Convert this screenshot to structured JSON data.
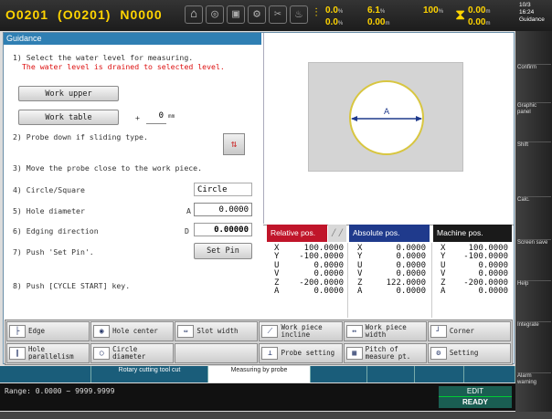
{
  "header": {
    "o_number": "O0201",
    "o_sub": "(O0201)",
    "n_number": "N0000",
    "stat1_a": "0.0",
    "stat1_a_unit": "%",
    "stat1_b": "0.0",
    "stat1_b_unit": "%",
    "stat2_a": "6.1",
    "stat2_a_unit": "%",
    "stat2_b": "0.00",
    "stat2_b_unit": "m",
    "stat3": "100",
    "stat3_unit": "%",
    "stat4_a": "0.00",
    "stat4_a_unit": "m",
    "stat4_b": "0.00",
    "stat4_b_unit": "m",
    "clock_1": "10/3",
    "clock_2": "16:24",
    "clock_3": "Guidance"
  },
  "guidance": {
    "title": "Guidance",
    "step1": "1) Select the water level for measuring.",
    "step1_note": "The water level is drained to selected level.",
    "btn_work_upper": "Work upper",
    "btn_work_table": "Work table",
    "offset_sign": "+",
    "offset_value": "0",
    "offset_unit": "mm",
    "step2": "2) Probe down if sliding type.",
    "step3": "3) Move the probe close to the work piece.",
    "step4": "4) Circle/Square",
    "shape_value": "Circle",
    "step5": "5) Hole diameter",
    "hole_label": "A",
    "hole_value": "0.0000",
    "step6": "6) Edging direction",
    "edging_label": "D",
    "edging_value": "0.00000",
    "step7": "7) Push 'Set Pin'.",
    "btn_set_pin": "Set Pin",
    "step8": "8) Push [CYCLE START] key.",
    "picture_label": "A"
  },
  "positions": {
    "relative_header": "Relative pos.",
    "absolute_header": "Absolute pos.",
    "machine_header": "Machine pos.",
    "axes": [
      "X",
      "Y",
      "U",
      "V",
      "Z",
      "A"
    ],
    "relative": [
      "100.0000",
      "-100.0000",
      "0.0000",
      "0.0000",
      "-200.0000",
      "0.0000"
    ],
    "absolute": [
      "0.0000",
      "0.0000",
      "0.0000",
      "0.0000",
      "122.0000",
      "0.0000"
    ],
    "machine": [
      "100.0000",
      "-100.0000",
      "0.0000",
      "0.0000",
      "-200.0000",
      "0.0000"
    ]
  },
  "softkeys": [
    {
      "label": "Edge",
      "icon": "edge-icon"
    },
    {
      "label": "Hole center",
      "icon": "hole-center-icon"
    },
    {
      "label": "Slot width",
      "icon": "slot-width-icon"
    },
    {
      "label": "Work piece incline",
      "icon": "incline-icon"
    },
    {
      "label": "Work piece width",
      "icon": "width-icon"
    },
    {
      "label": "Corner",
      "icon": "corner-icon"
    },
    {
      "label": "Hole parallelism",
      "icon": "parallel-icon"
    },
    {
      "label": "Circle diameter",
      "icon": "circle-icon"
    },
    {
      "label": "",
      "icon": ""
    },
    {
      "label": "Probe setting",
      "icon": "probe-icon"
    },
    {
      "label": "Pitch of measure pt.",
      "icon": "pitch-icon"
    },
    {
      "label": "Setting",
      "icon": "setting-icon"
    }
  ],
  "right_menu": [
    "Confirm",
    "Graphic panel",
    "Shift",
    "Calc.",
    "Screen save",
    "Help",
    "Integrate",
    "Alarm warning"
  ],
  "bottom_tabs": [
    "",
    "Rotary cutting tool cut",
    "Measuring by probe",
    "",
    "",
    "",
    ""
  ],
  "status": {
    "range": "Range: 0.0000 ~ 9999.9999",
    "mode": "EDIT",
    "state": "READY"
  },
  "colors": {
    "accent": "#2f7fb3",
    "relative_bg": "#c0152a",
    "absolute_bg": "#1f3a8c",
    "machine_bg": "#1a1a1a"
  }
}
